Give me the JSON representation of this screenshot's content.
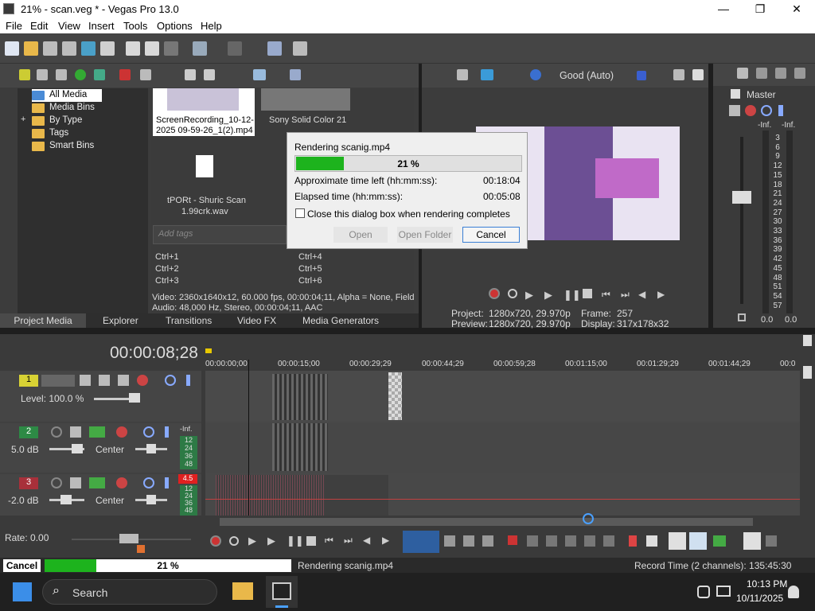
{
  "window": {
    "title": "21% - scan.veg * - Vegas Pro 13.0",
    "minimize": "—",
    "maximize": "❐",
    "close": "✕"
  },
  "menu": [
    "File",
    "Edit",
    "View",
    "Insert",
    "Tools",
    "Options",
    "Help"
  ],
  "media": {
    "tree": [
      "All Media",
      "Media Bins",
      "By Type",
      "Tags",
      "Smart Bins"
    ],
    "tree_expander": "+",
    "items": [
      {
        "name": "ScreenRecording_10-12-2025 09-59-26_1(2).mp4",
        "line1": "ScreenRecording_10-12-",
        "line2": "2025 09-59-26_1(2).mp4"
      },
      {
        "name": "Sony Solid Color 21",
        "line1": "Sony Solid Color 21",
        "line2": ""
      },
      {
        "name": "tPORt - Shuric Scan 1.99crk.wav",
        "line1": "tPORt - Shuric Scan",
        "line2": "1.99crk.wav"
      }
    ],
    "tags_placeholder": "Add tags",
    "hotkeys": [
      "Ctrl+1",
      "Ctrl+2",
      "Ctrl+3",
      "Ctrl+4",
      "Ctrl+5",
      "Ctrl+6"
    ],
    "info_video": "Video: 2360x1640x12, 60.000 fps, 00:00:04;11, Alpha = None, Field",
    "info_audio": "Audio: 48,000 Hz, Stereo, 00:00:04;11, AAC",
    "tabs": [
      "Project Media",
      "Explorer",
      "Transitions",
      "Video FX",
      "Media Generators"
    ]
  },
  "preview": {
    "quality": "Good (Auto)",
    "project_label": "Project:",
    "project_value": "1280x720, 29.970p",
    "preview_label": "Preview:",
    "preview_value": "1280x720, 29.970p",
    "frame_label": "Frame:",
    "frame_value": "257",
    "display_label": "Display:",
    "display_value": "317x178x32"
  },
  "master": {
    "title": "Master",
    "inf_left": "-Inf.",
    "inf_right": "-Inf.",
    "scale": [
      "3",
      "6",
      "9",
      "12",
      "15",
      "18",
      "21",
      "24",
      "27",
      "30",
      "33",
      "36",
      "39",
      "42",
      "45",
      "48",
      "51",
      "54",
      "57"
    ],
    "bottom_left": "0.0",
    "bottom_right": "0.0"
  },
  "dialog": {
    "title": "Rendering scanig.mp4",
    "progress_text": "21 %",
    "progress": 0.21,
    "time_left_label": "Approximate time left (hh:mm:ss):",
    "time_left_value": "00:18:04",
    "elapsed_label": "Elapsed time (hh:mm:ss):",
    "elapsed_value": "00:05:08",
    "checkbox_label": "Close this dialog box when rendering completes",
    "open_label": "Open",
    "open_folder_label": "Open Folder",
    "cancel_label": "Cancel"
  },
  "timeline": {
    "timecode": "00:00:08;28",
    "ruler": [
      "00:00:00;00",
      "00:00:15;00",
      "00:00:29;29",
      "00:00:44;29",
      "00:00:59;28",
      "00:01:15;00",
      "00:01:29;29",
      "00:01:44;29",
      "00:0"
    ],
    "tracks": [
      {
        "num": "1",
        "label": "Level: 100.0 %"
      },
      {
        "num": "2",
        "label": "5.0 dB",
        "pan": "Center",
        "meter_top": "-Inf."
      },
      {
        "num": "3",
        "label": "-2.0 dB",
        "pan": "Center",
        "meter_top": "4.5"
      }
    ],
    "meter_scale": [
      "12",
      "24",
      "36",
      "48"
    ],
    "rate": "Rate: 0.00"
  },
  "status": {
    "cancel_label": "Cancel",
    "progress_text": "21 %",
    "progress": 0.21,
    "message": "Rendering scanig.mp4",
    "record_time": "Record Time (2 channels): 135:45:30"
  },
  "taskbar": {
    "search_label": "Search",
    "time": "10:13 PM",
    "date": "10/11/2025"
  },
  "colors": {
    "progress_green": "#1db31d",
    "accent_blue": "#3a7fd5",
    "track2": "#2d8a45",
    "track3": "#a8303a"
  }
}
